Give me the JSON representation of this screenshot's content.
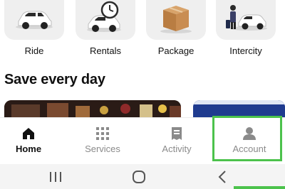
{
  "services": [
    {
      "label": "Ride",
      "icon": "car-icon"
    },
    {
      "label": "Rentals",
      "icon": "car-clock-icon"
    },
    {
      "label": "Package",
      "icon": "package-box-icon"
    },
    {
      "label": "Intercity",
      "icon": "traveler-car-icon"
    }
  ],
  "section": {
    "title": "Save every day"
  },
  "nav": {
    "items": [
      {
        "label": "Home",
        "icon": "home-icon",
        "active": true
      },
      {
        "label": "Services",
        "icon": "grid-icon",
        "active": false
      },
      {
        "label": "Activity",
        "icon": "receipt-icon",
        "active": false
      },
      {
        "label": "Account",
        "icon": "person-icon",
        "active": false
      }
    ]
  },
  "system_nav": {
    "buttons": [
      "recent-apps-icon",
      "home-circle-icon",
      "back-chevron-icon"
    ]
  },
  "colors": {
    "highlight": "#4cc24c",
    "tile_bg": "#efefef",
    "active_text": "#111111",
    "inactive_text": "#8a8a8a"
  }
}
